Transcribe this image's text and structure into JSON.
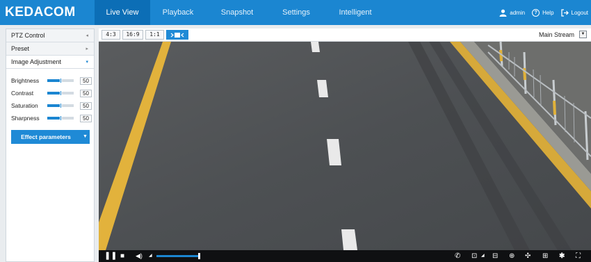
{
  "app": {
    "logo": "KEDACOM"
  },
  "nav": {
    "items": [
      "Live View",
      "Playback",
      "Snapshot",
      "Settings",
      "Intelligent"
    ],
    "active_index": 0
  },
  "user": {
    "name": "admin",
    "help": "Help",
    "logout": "Logout"
  },
  "sidebar": {
    "sections": [
      {
        "label": "PTZ Control",
        "arrow": "◂"
      },
      {
        "label": "Preset",
        "arrow": "▸"
      },
      {
        "label": "Image Adjustment",
        "arrow": "▾"
      }
    ],
    "adjustments": [
      {
        "name": "Brightness",
        "value": "50",
        "level": 0.5
      },
      {
        "name": "Contrast",
        "value": "50",
        "level": 0.5
      },
      {
        "name": "Saturation",
        "value": "50",
        "level": 0.5
      },
      {
        "name": "Sharpness",
        "value": "50",
        "level": 0.5
      }
    ],
    "effect_button": "Effect parameters"
  },
  "video_toolbar": {
    "ratios": [
      "4:3",
      "16:9",
      "1:1"
    ],
    "fullscreen_icon": "fit-window-icon",
    "stream": "Main Stream"
  },
  "controls": {
    "volume_level": 1.0
  },
  "colors": {
    "accent": "#1b86d1",
    "nav_active": "#0c6eb6",
    "road_line": "#e0b13a"
  }
}
